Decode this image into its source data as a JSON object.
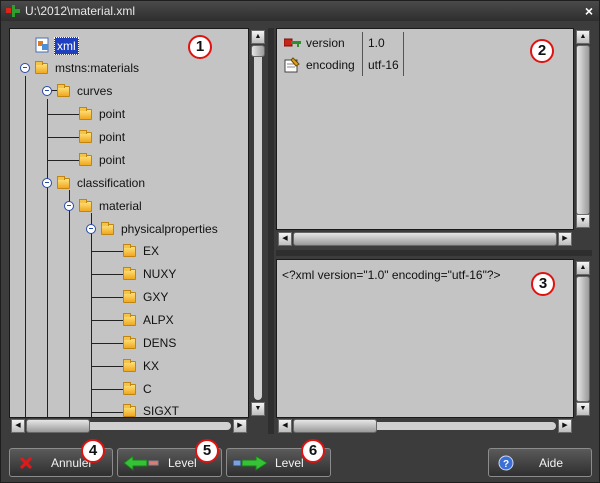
{
  "window": {
    "title": "U:\\2012\\material.xml",
    "close_label": "×"
  },
  "tree": {
    "nodes": [
      {
        "label": "xml"
      },
      {
        "label": "mstns:materials"
      },
      {
        "label": "curves"
      },
      {
        "label": "point"
      },
      {
        "label": "point"
      },
      {
        "label": "point"
      },
      {
        "label": "classification"
      },
      {
        "label": "material"
      },
      {
        "label": "physicalproperties"
      },
      {
        "label": "EX"
      },
      {
        "label": "NUXY"
      },
      {
        "label": "GXY"
      },
      {
        "label": "ALPX"
      },
      {
        "label": "DENS"
      },
      {
        "label": "KX"
      },
      {
        "label": "C"
      },
      {
        "label": "SIGXT"
      }
    ]
  },
  "attributes": {
    "rows": [
      {
        "name": "version",
        "value": "1.0",
        "icon": "key-icon"
      },
      {
        "name": "encoding",
        "value": "utf-16",
        "icon": "edit-icon"
      }
    ]
  },
  "source": {
    "text": "<?xml version=\"1.0\" encoding=\"utf-16\"?>"
  },
  "buttons": {
    "cancel": {
      "label": "Annuler",
      "icon": "red-x-icon"
    },
    "level_up": {
      "label": "Level",
      "icon": "green-left-arrow-icon"
    },
    "level_down": {
      "label": "Level",
      "icon": "green-right-arrow-icon"
    },
    "help": {
      "label": "Aide",
      "icon": "help-circle-icon"
    }
  },
  "callouts": [
    "1",
    "2",
    "3",
    "4",
    "5",
    "6"
  ],
  "colors": {
    "accent_selection": "#1f3fbf",
    "callout_border": "#e0120f",
    "panel_bg": "#c4c4c4"
  }
}
